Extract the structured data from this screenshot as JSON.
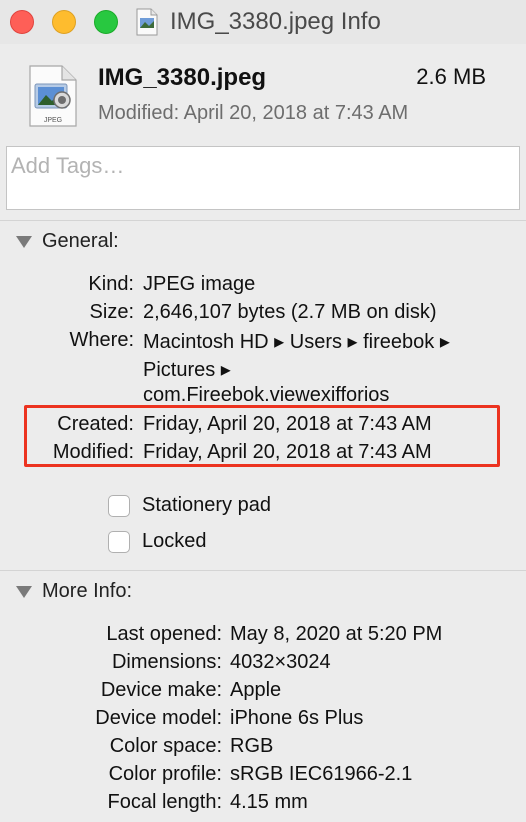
{
  "window": {
    "title": "IMG_3380.jpeg Info"
  },
  "header": {
    "file_name": "IMG_3380.jpeg",
    "file_size": "2.6 MB",
    "modified": "Modified: April 20, 2018 at 7:43 AM",
    "icon_label": "JPEG"
  },
  "tags": {
    "placeholder": "Add Tags…"
  },
  "general": {
    "title": "General:",
    "rows": [
      {
        "label": "Kind:",
        "value": "JPEG image"
      },
      {
        "label": "Size:",
        "value": "2,646,107 bytes (2.7 MB on disk)"
      },
      {
        "label": "Where:",
        "value": "Macintosh HD ▸ Users ▸ fireebok ▸"
      },
      {
        "label": "",
        "value": "Pictures ▸"
      },
      {
        "label": "",
        "value": "com.Fireebok.viewexifforios"
      },
      {
        "label": "Created:",
        "value": "Friday, April 20, 2018 at 7:43 AM"
      },
      {
        "label": "Modified:",
        "value": "Friday, April 20, 2018 at 7:43 AM"
      }
    ],
    "stationery_pad_label": "Stationery pad",
    "locked_label": "Locked"
  },
  "more_info": {
    "title": "More Info:",
    "rows": [
      {
        "label": "Last opened:",
        "value": "May 8, 2020 at 5:20 PM"
      },
      {
        "label": "Dimensions:",
        "value": "4032×3024"
      },
      {
        "label": "Device make:",
        "value": "Apple"
      },
      {
        "label": "Device model:",
        "value": "iPhone 6s Plus"
      },
      {
        "label": "Color space:",
        "value": "RGB"
      },
      {
        "label": "Color profile:",
        "value": "sRGB IEC61966-2.1"
      },
      {
        "label": "Focal length:",
        "value": "4.15 mm"
      }
    ]
  },
  "colors": {
    "highlight_border": "#ec3320",
    "close": "#fe5f57",
    "minimize": "#febc2e",
    "zoom": "#28c840"
  }
}
